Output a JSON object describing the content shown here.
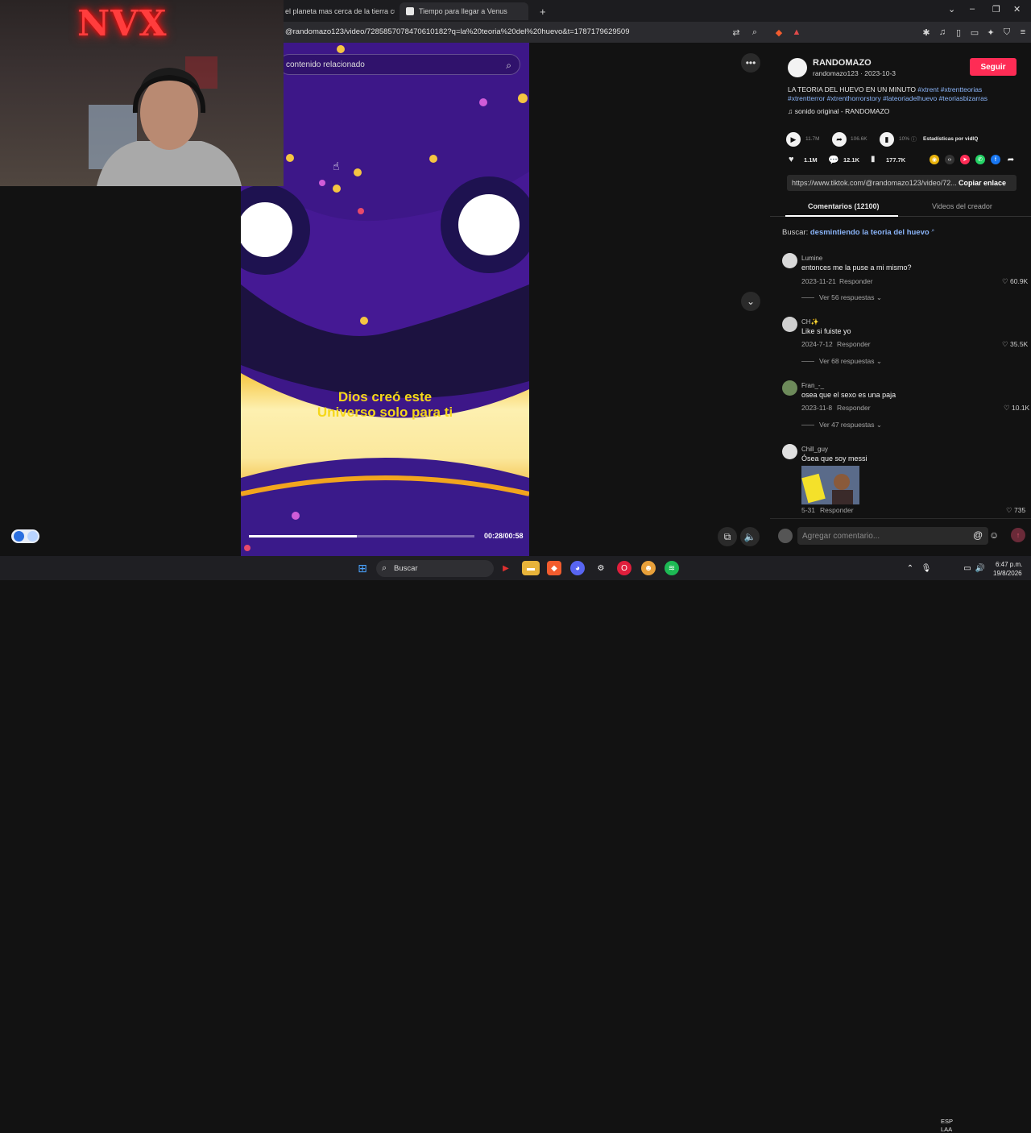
{
  "browser": {
    "tabs": [
      {
        "title": "el planeta mas cerca de la tierra cuan"
      },
      {
        "title": "Tiempo para llegar a Venus"
      }
    ],
    "new_tab": "+",
    "url": "@randomazo123/video/7285857078470610182?q=la%20teoria%20del%20huevo&t=1787179629509",
    "window_controls": {
      "dropdown": "⌄",
      "minimize": "–",
      "restore": "❐",
      "close": "✕"
    }
  },
  "webcam": {
    "neon_sign": "NVX"
  },
  "video": {
    "search_placeholder": "contenido relacionado",
    "subtitle_line1": "Dios creó este",
    "subtitle_line2": "Universo solo para ti",
    "time": "00:28/00:58",
    "progress": 0.48
  },
  "sidebar": {
    "author_name": "RANDOMAZO",
    "author_handle": "randomazo123 · 2023-10-3",
    "follow_label": "Seguir",
    "caption": "LA TEORIA DEL HUEVO EN UN MINUTO",
    "hashtags_line1": "#xtrent #xtrentteorias",
    "hashtags_line2_a": "#xtrentterror",
    "hashtags_line2_b": "#xtrenthorrorstory #lateoriadelhuevo #teoriasbizarras",
    "sound": "sonido original - RANDOMAZO",
    "stats_plays": "11.7M",
    "stats_shares": "106.6K",
    "stats_percent": "10%",
    "stats_label": "Estadísticas por vidIQ",
    "likes": "1.1M",
    "comments": "12.1K",
    "saves": "177.7K",
    "link": "https://www.tiktok.com/@randomazo123/video/72...",
    "copy_link": "Copiar enlace",
    "tab_comments": "Comentarios (12100)",
    "tab_creator": "Videos del creador",
    "search_prefix": "Buscar:",
    "search_term": "desmintiendo la teoria del huevo",
    "comments_list": [
      {
        "name": "Lumine",
        "text": "entonces me la puse a mi mismo?",
        "date": "2023-11-21",
        "reply": "Responder",
        "likes": "60.9K",
        "replies": "Ver 56 respuestas"
      },
      {
        "name": "CH✨",
        "text": "Like si fuiste yo",
        "date": "2024-7-12",
        "reply": "Responder",
        "likes": "35.5K",
        "replies": "Ver 68 respuestas"
      },
      {
        "name": "Fran_-_",
        "text": "osea que el sexo es una paja",
        "date": "2023-11-8",
        "reply": "Responder",
        "likes": "10.1K",
        "replies": "Ver 47 respuestas"
      },
      {
        "name": "Chill_guy",
        "text": "Ósea que soy messi",
        "date": "5-31",
        "reply": "Responder",
        "likes": "735"
      }
    ],
    "add_comment_placeholder": "Agregar comentario..."
  },
  "taskbar": {
    "search_label": "Buscar",
    "lang_line1": "ESP",
    "lang_line2": "LAA",
    "time": "6:47 p.m.",
    "date": "19/8/2026"
  },
  "colors": {
    "accent": "#fe2c55",
    "video_bg": "#3d1788",
    "subtitle": "#f5d71a"
  }
}
